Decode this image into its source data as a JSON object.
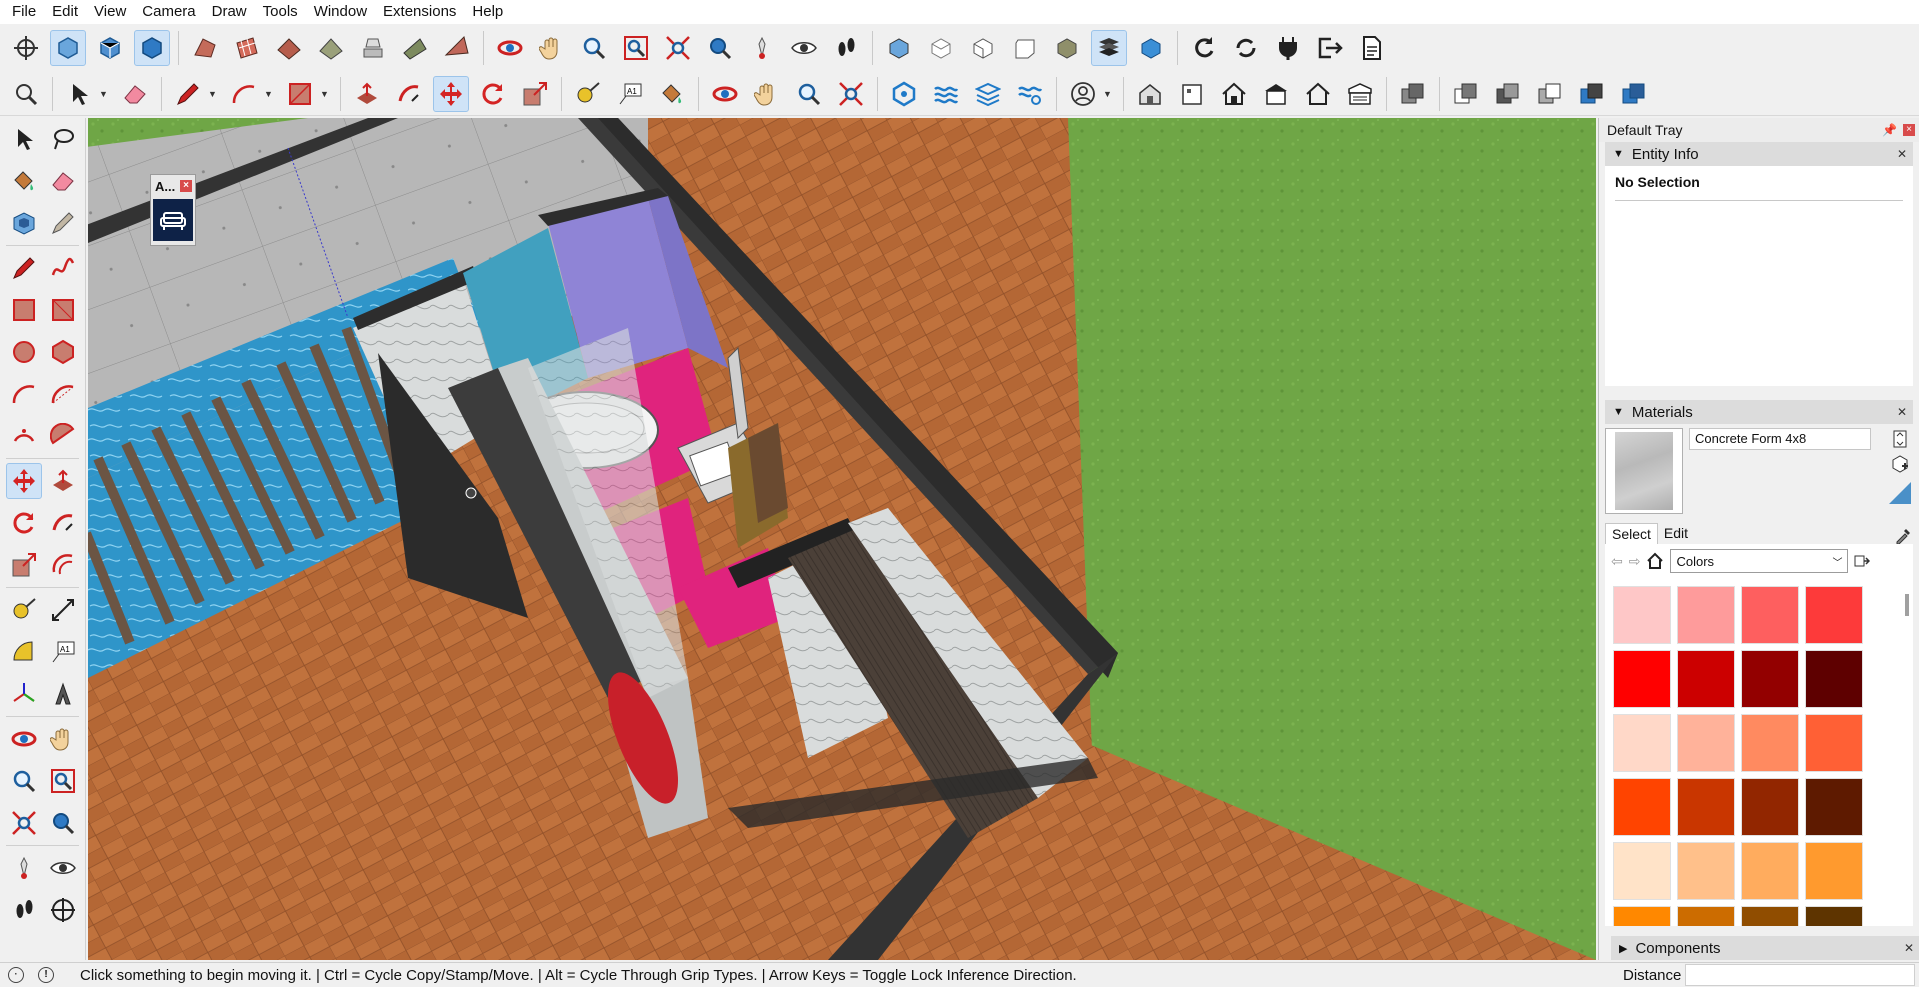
{
  "menu": [
    "File",
    "Edit",
    "View",
    "Camera",
    "Draw",
    "Tools",
    "Window",
    "Extensions",
    "Help"
  ],
  "mini_toolbar": {
    "title": "A...",
    "close": "×"
  },
  "tray": {
    "title": "Default Tray",
    "entity_info": {
      "header": "Entity Info",
      "value": "No Selection"
    },
    "materials": {
      "header": "Materials",
      "current_name": "Concrete Form 4x8",
      "tabs": [
        "Select",
        "Edit"
      ],
      "library": "Colors",
      "swatches": [
        [
          "#fec7c7",
          "#fe9b9b",
          "#fe5f5f",
          "#fd3a3a"
        ],
        [
          "#ff0000",
          "#cc0000",
          "#930000",
          "#5e0000"
        ],
        [
          "#ffd8c8",
          "#ffb29a",
          "#ff8a60",
          "#ff6035"
        ],
        [
          "#ff4400",
          "#c93600",
          "#922600",
          "#5e1a00"
        ],
        [
          "#ffe3c8",
          "#ffc08a",
          "#ffac5e",
          "#ff9a2e"
        ],
        [
          "#ff8800",
          "#cc6c00",
          "#904d00",
          "#5e3400"
        ]
      ]
    },
    "components": {
      "header": "Components"
    }
  },
  "status": {
    "message": "Click something to begin moving it. | Ctrl = Cycle Copy/Stamp/Move. | Alt = Cycle Through Grip Types. | Arrow Keys = Toggle Lock Inference Direction.",
    "measure_label": "Distance",
    "measure_value": ""
  },
  "colors": {
    "grass": "#6fa646",
    "floor": "#b86a3a",
    "wall_dark": "#3a3a3a",
    "concrete": "#b9b9b9",
    "water": "#2f95c9",
    "magenta": "#e0237d",
    "lavender": "#8f84d6",
    "selection_blue": "#cfe3f7"
  }
}
